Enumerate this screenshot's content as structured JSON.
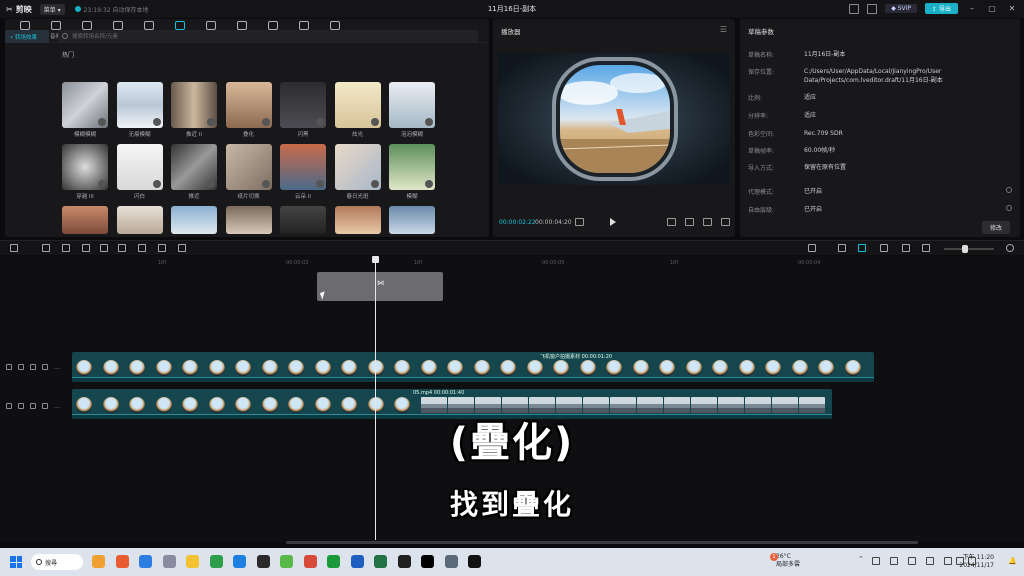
{
  "titlebar": {
    "app_name": "剪映",
    "menu_label": "菜单",
    "autosave": "23:19:32 自动保存本地",
    "title": "11月16日-副本",
    "svip": "SVIP",
    "export": "导出"
  },
  "tool_tabs": [
    {
      "label": "媒体",
      "icon": "media-icon"
    },
    {
      "label": "音频",
      "icon": "audio-icon"
    },
    {
      "label": "文本",
      "icon": "text-icon"
    },
    {
      "label": "贴纸",
      "icon": "sticker-icon"
    },
    {
      "label": "特效",
      "icon": "effects-icon"
    },
    {
      "label": "转场",
      "icon": "transition-icon",
      "active": true
    },
    {
      "label": "字幕",
      "icon": "caption-icon"
    },
    {
      "label": "滤镜",
      "icon": "filter-icon"
    },
    {
      "label": "调节",
      "icon": "adjust-icon"
    },
    {
      "label": "模板",
      "icon": "template-icon"
    },
    {
      "label": "数字人",
      "icon": "avatar-icon"
    }
  ],
  "media_panel": {
    "side_category": "• 转场效果",
    "search_placeholder": "搜索转场名称/元素",
    "section_title": "热门",
    "items": [
      {
        "label": "模糊模糊"
      },
      {
        "label": "无痕模糊"
      },
      {
        "label": "推近 II"
      },
      {
        "label": "叠化"
      },
      {
        "label": "闪黑"
      },
      {
        "label": "炫光"
      },
      {
        "label": "泡泡模糊"
      },
      {
        "label": "穿越 III"
      },
      {
        "label": "闪白"
      },
      {
        "label": "推近"
      },
      {
        "label": "纸片切换"
      },
      {
        "label": "云朵 II"
      },
      {
        "label": "春日光斑"
      },
      {
        "label": "模糊"
      },
      {
        "label": ""
      },
      {
        "label": ""
      },
      {
        "label": ""
      },
      {
        "label": ""
      },
      {
        "label": ""
      },
      {
        "label": ""
      },
      {
        "label": ""
      }
    ]
  },
  "player": {
    "title": "播放器",
    "current_time": "00:00:02:22",
    "total_time": "00:00:04:20"
  },
  "params": {
    "title": "草稿参数",
    "rows": [
      {
        "key": "草稿名称:",
        "value": "11月16日-副本"
      },
      {
        "key": "保存位置:",
        "value": "C:/Users/User/AppData/Local/JianyingPro/User Data/Projects/com.lveditor.draft/11月16日-副本"
      },
      {
        "key": "比例:",
        "value": "适应"
      },
      {
        "key": "分辨率:",
        "value": "适应"
      },
      {
        "key": "色彩空间:",
        "value": "Rec.709 SDR"
      },
      {
        "key": "草稿帧率:",
        "value": "60.00帧/秒"
      },
      {
        "key": "导入方式:",
        "value": "保留在原有位置"
      },
      {
        "key": "代理模式:",
        "value": "已开启"
      },
      {
        "key": "自由层级:",
        "value": "已开启"
      }
    ],
    "edit_label": "修改"
  },
  "timeline": {
    "ruler_ticks": [
      "10f",
      "00:00:02",
      "10f",
      "00:00:05",
      "10f",
      "00:00:04"
    ],
    "clip_top_label": "飞机窗户拍摄素材  00:00:01:20",
    "clip_bottom_label": "05.mp4  00:00:01:40"
  },
  "subtitles": {
    "main": "(疊化)",
    "secondary": "找到疊化"
  },
  "taskbar": {
    "search_label": "搜尋",
    "weather_temp": "26°C",
    "weather_desc": "局部多雲",
    "weather_badge": "1",
    "time": "下午 11:20",
    "date": "2024/11/17"
  }
}
